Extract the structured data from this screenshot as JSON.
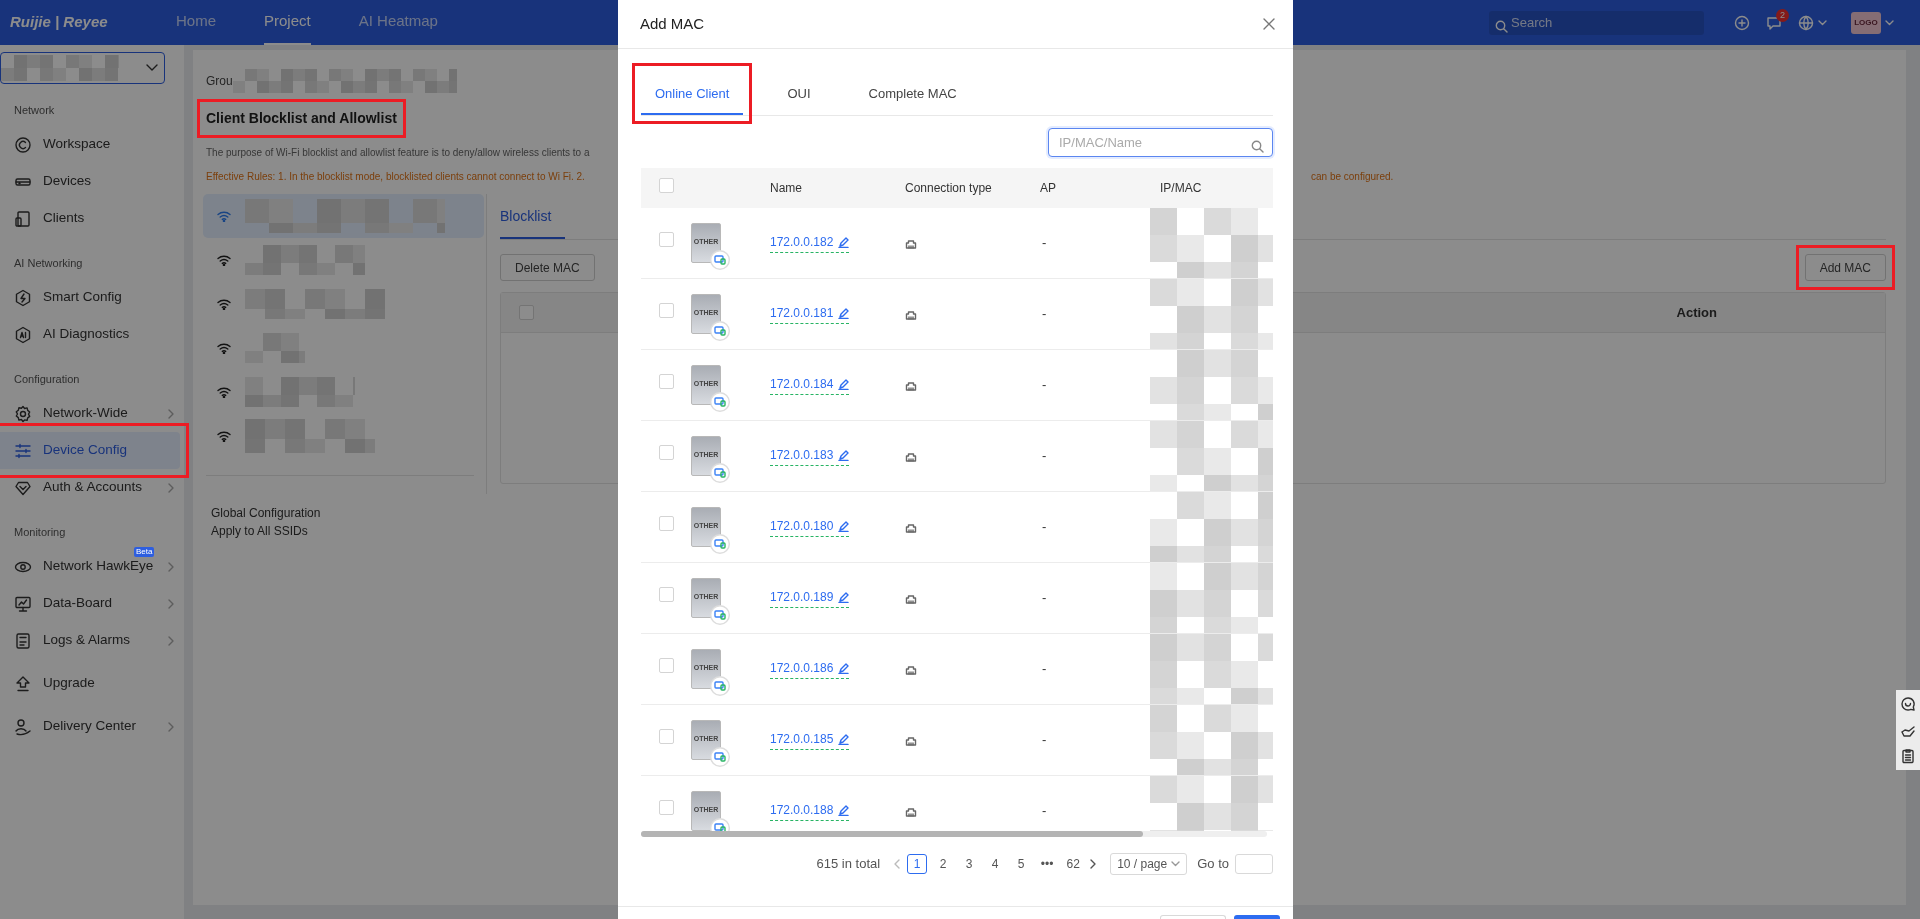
{
  "top_nav": {
    "logo": "Ruijie | Reyee",
    "items": [
      {
        "label": "Home",
        "selected": false
      },
      {
        "label": "Project",
        "selected": true
      },
      {
        "label": "AI Heatmap",
        "selected": false
      }
    ],
    "search": {
      "placeholder": "Search"
    },
    "notification_count": "2",
    "avatar_label": "LOGO"
  },
  "sidebar": {
    "sections": [
      {
        "title": "Network",
        "items": [
          {
            "label": "Workspace",
            "selected": false,
            "expandable": false,
            "highlighted": false
          },
          {
            "label": "Devices",
            "selected": false,
            "expandable": false,
            "highlighted": false
          },
          {
            "label": "Clients",
            "selected": false,
            "expandable": false,
            "highlighted": false
          }
        ]
      },
      {
        "title": "AI Networking",
        "items": [
          {
            "label": "Smart Config",
            "selected": false,
            "expandable": false,
            "highlighted": false
          },
          {
            "label": "AI Diagnostics",
            "selected": false,
            "expandable": false,
            "highlighted": false
          }
        ]
      },
      {
        "title": "Configuration",
        "items": [
          {
            "label": "Network-Wide",
            "selected": false,
            "expandable": true,
            "highlighted": false
          },
          {
            "label": "Device Config",
            "selected": true,
            "expandable": false,
            "highlighted": true
          },
          {
            "label": "Auth & Accounts",
            "selected": false,
            "expandable": true,
            "highlighted": false
          }
        ]
      },
      {
        "title": "Monitoring",
        "items": [
          {
            "label": "Network HawkEye",
            "selected": false,
            "expandable": true,
            "highlighted": false,
            "badge": "Beta"
          },
          {
            "label": "Data-Board",
            "selected": false,
            "expandable": true,
            "highlighted": false
          },
          {
            "label": "Logs & Alarms",
            "selected": false,
            "expandable": true,
            "highlighted": false
          }
        ]
      },
      {
        "items": [
          {
            "label": "Upgrade",
            "selected": false,
            "expandable": false,
            "highlighted": false
          },
          {
            "label": "Delivery Center",
            "selected": false,
            "expandable": true,
            "highlighted": false
          }
        ]
      }
    ]
  },
  "page": {
    "group_label": "Grou",
    "title": "Client Blocklist and Allowlist",
    "title_highlighted": true,
    "description": "The purpose of Wi-Fi blocklist and allowlist feature is to deny/allow wireless clients to a",
    "rules": "Effective Rules: 1. In the blocklist mode, blocklisted clients cannot connect to Wi Fi. 2.",
    "rules_end": "can be configured.",
    "ssids": [
      {
        "selected": true
      },
      {
        "selected": false
      },
      {
        "selected": false
      },
      {
        "selected": false
      },
      {
        "selected": false
      },
      {
        "selected": false
      }
    ],
    "global_config": [
      "Global Configuration",
      "Apply to All SSIDs"
    ],
    "list_tabs": [
      {
        "label": "Blocklist",
        "selected": true
      }
    ],
    "delete_button": "Delete MAC",
    "add_button": {
      "label": "Add MAC",
      "highlighted": true
    },
    "table": {
      "select_all_checked": false,
      "columns": [
        "Action"
      ]
    }
  },
  "modal": {
    "title": "Add MAC",
    "tabs": [
      {
        "label": "Online Client",
        "selected": true,
        "highlighted": true
      },
      {
        "label": "OUI",
        "selected": false,
        "highlighted": false
      },
      {
        "label": "Complete MAC",
        "selected": false,
        "highlighted": false
      }
    ],
    "search": {
      "placeholder": "IP/MAC/Name"
    },
    "select_all_checked": false,
    "columns": [
      "Name",
      "Connection type",
      "AP",
      "IP/MAC"
    ],
    "rows": [
      {
        "name": "172.0.0.182",
        "device_label": "OTHER",
        "ap": "-",
        "checked": false
      },
      {
        "name": "172.0.0.181",
        "device_label": "OTHER",
        "ap": "-",
        "checked": false
      },
      {
        "name": "172.0.0.184",
        "device_label": "OTHER",
        "ap": "-",
        "checked": false
      },
      {
        "name": "172.0.0.183",
        "device_label": "OTHER",
        "ap": "-",
        "checked": false
      },
      {
        "name": "172.0.0.180",
        "device_label": "OTHER",
        "ap": "-",
        "checked": false
      },
      {
        "name": "172.0.0.189",
        "device_label": "OTHER",
        "ap": "-",
        "checked": false
      },
      {
        "name": "172.0.0.186",
        "device_label": "OTHER",
        "ap": "-",
        "checked": false
      },
      {
        "name": "172.0.0.185",
        "device_label": "OTHER",
        "ap": "-",
        "checked": false
      },
      {
        "name": "172.0.0.188",
        "device_label": "OTHER",
        "ap": "-",
        "checked": false
      }
    ],
    "pagination": {
      "total": "615 in total",
      "pages": [
        {
          "label": "1",
          "selected": true
        },
        {
          "label": "2",
          "selected": false
        },
        {
          "label": "3",
          "selected": false
        },
        {
          "label": "4",
          "selected": false
        },
        {
          "label": "5",
          "selected": false
        },
        {
          "label": "•••",
          "selected": false
        },
        {
          "label": "62",
          "selected": false
        }
      ],
      "page_size": "10 / page",
      "goto_label": "Go to"
    }
  }
}
